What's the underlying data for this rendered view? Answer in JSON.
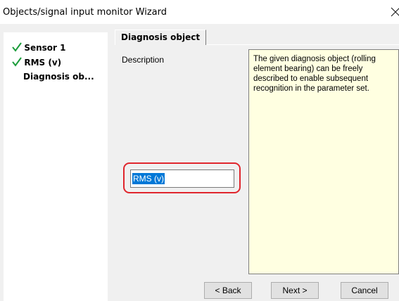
{
  "window": {
    "title": "Objects/signal input monitor Wizard",
    "close_icon": "close-icon"
  },
  "steps": [
    {
      "label": "Sensor 1",
      "state": "done",
      "icon": "checkmark-icon"
    },
    {
      "label": "RMS (v)",
      "state": "done",
      "icon": "checkmark-icon"
    },
    {
      "label": "Diagnosis ob...",
      "state": "current"
    }
  ],
  "tab": {
    "label": "Diagnosis object"
  },
  "form": {
    "description_label": "Description",
    "description_value": "RMS (v)",
    "help_text": "The given diagnosis object (rolling element bearing) can be freely described to enable subsequent recognition in the parameter set."
  },
  "buttons": {
    "back": "< Back",
    "next": "Next >",
    "cancel": "Cancel"
  },
  "colors": {
    "check": "#1a9c3a",
    "selection": "#0078d7",
    "highlight": "#e0262d",
    "help_bg": "#ffffe1"
  }
}
